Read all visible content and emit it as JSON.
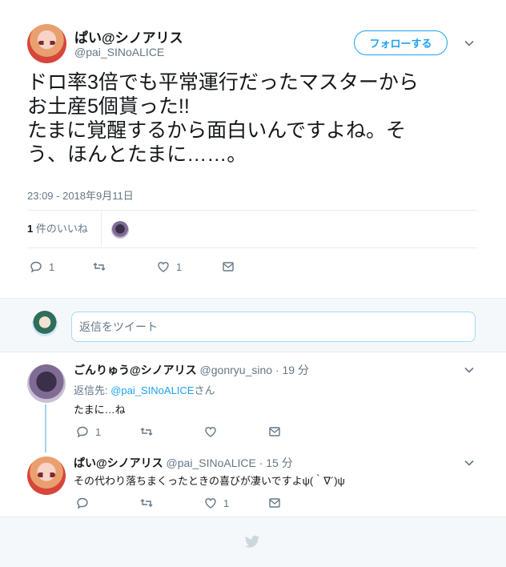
{
  "tweet": {
    "display_name": "ぱい@シノアリス",
    "handle": "@pai_SINoALICE",
    "follow_label": "フォローする",
    "text": "ドロ率3倍でも平常運行だったマスターから\nお土産5個貰った!!\nたまに覚醒するから面白いんですよね。そ\nう、ほんとたまに……。",
    "timestamp": "23:09 - 2018年9月11日",
    "likes_count": "1",
    "likes_suffix": " 件のいいね",
    "actions": {
      "reply_count": "1",
      "retweet_count": "",
      "like_count": "1"
    }
  },
  "reply_box": {
    "placeholder": "返信をツイート"
  },
  "replies": [
    {
      "display_name": "ごんりゅう@シノアリス",
      "handle": "@gonryu_sino",
      "time": "· 19 分",
      "reply_prefix": "返信先: ",
      "reply_target": "@pai_SINoALICE",
      "reply_suffix": "さん",
      "text": "たまに…ね",
      "actions": {
        "reply_count": "1",
        "retweet_count": "",
        "like_count": ""
      }
    },
    {
      "display_name": "ぱい@シノアリス",
      "handle": "@pai_SINoALICE",
      "time": "· 15 分",
      "text": "その代わり落ちまくったときの喜びが凄いですよψ(｀∇´)ψ",
      "actions": {
        "reply_count": "",
        "retweet_count": "",
        "like_count": "1"
      }
    }
  ],
  "icons": [
    "reply-icon",
    "retweet-icon",
    "heart-icon",
    "dm-icon",
    "chevron-down-icon",
    "twitter-bird-icon"
  ],
  "colors": {
    "accent": "#1da1f2",
    "muted": "#657786",
    "text": "#14171a",
    "border": "#e6ecf0"
  }
}
